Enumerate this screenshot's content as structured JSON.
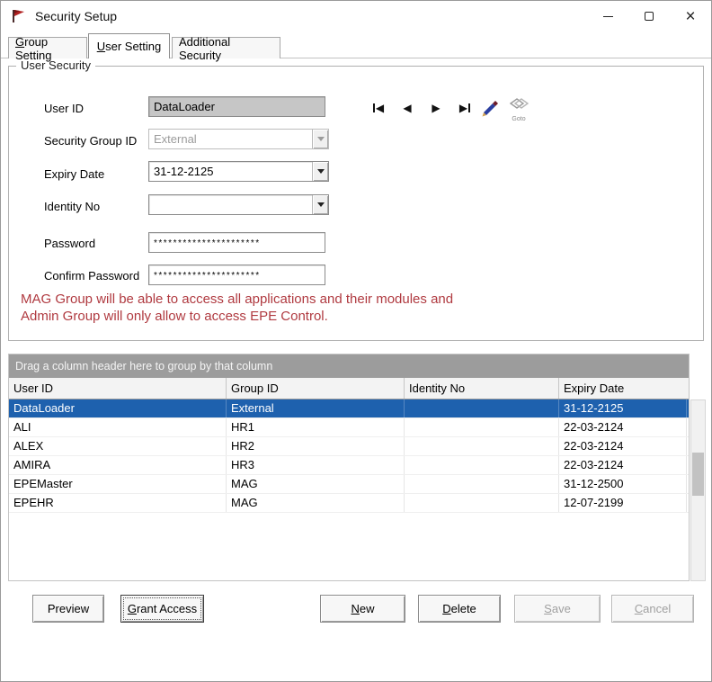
{
  "window": {
    "title": "Security Setup"
  },
  "icons": {
    "close": "×",
    "nav_first": "◀",
    "nav_prev": "◀",
    "nav_next": "▶",
    "nav_last": "▶",
    "goto_label": "Goto"
  },
  "colors": {
    "selection": "#1E61AE",
    "message": "#B03A40",
    "groupbar": "#9C9C9C"
  },
  "tabs": {
    "group_setting": {
      "k": "G",
      "rest": "roup Setting"
    },
    "user_setting": {
      "k": "U",
      "rest": "ser Setting"
    },
    "additional_security": {
      "label": "Additional Security"
    }
  },
  "form": {
    "legend": "User Security",
    "user_id": {
      "label": "User ID",
      "value": "DataLoader"
    },
    "security_group_id": {
      "label": "Security Group ID",
      "value": "External"
    },
    "expiry_date": {
      "label": "Expiry Date",
      "value": "31-12-2125"
    },
    "identity_no": {
      "label": "Identity No",
      "value": ""
    },
    "password": {
      "label": "Password",
      "value": "**********************"
    },
    "confirm_password": {
      "label": "Confirm Password",
      "value": "**********************"
    }
  },
  "message": {
    "line1": "MAG Group will be able to access all applications and their modules and",
    "line2": "Admin Group will only allow to access EPE Control."
  },
  "grid": {
    "groupby_hint": "Drag a column header here to group by that column",
    "columns": [
      "User ID",
      "Group ID",
      "Identity No",
      "Expiry Date"
    ],
    "rows": [
      {
        "cells": [
          "DataLoader",
          "External",
          "",
          "31-12-2125"
        ],
        "selected": true
      },
      {
        "cells": [
          "ALI",
          "HR1",
          "",
          "22-03-2124"
        ],
        "selected": false
      },
      {
        "cells": [
          "ALEX",
          "HR2",
          "",
          "22-03-2124"
        ],
        "selected": false
      },
      {
        "cells": [
          "AMIRA",
          "HR3",
          "",
          "22-03-2124"
        ],
        "selected": false
      },
      {
        "cells": [
          "EPEMaster",
          "MAG",
          "",
          "31-12-2500"
        ],
        "selected": false
      },
      {
        "cells": [
          "EPEHR",
          "MAG",
          "",
          "12-07-2199"
        ],
        "selected": false
      }
    ]
  },
  "buttons": {
    "preview": {
      "label": "Preview"
    },
    "grant_access": {
      "k": "G",
      "rest": "rant Access"
    },
    "new": {
      "k": "N",
      "rest": "ew"
    },
    "delete": {
      "k": "D",
      "rest": "elete"
    },
    "save": {
      "k": "S",
      "rest": "ave"
    },
    "cancel": {
      "k": "C",
      "rest": "ancel"
    }
  }
}
